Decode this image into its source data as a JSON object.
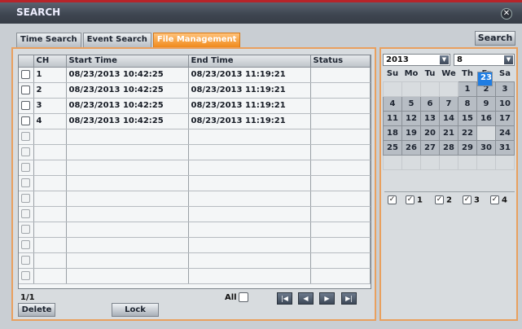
{
  "window": {
    "title": "SEARCH",
    "close_symbol": "✕"
  },
  "tabs": [
    {
      "label": "Time Search",
      "active": false
    },
    {
      "label": "Event Search",
      "active": false
    },
    {
      "label": "File Management",
      "active": true
    }
  ],
  "search_button": "Search",
  "table": {
    "columns": [
      "",
      "CH",
      "Start Time",
      "End Time",
      "Status"
    ],
    "rows": [
      {
        "ch": "1",
        "start": "08/23/2013 10:42:25",
        "end": "08/23/2013 11:19:21",
        "status": ""
      },
      {
        "ch": "2",
        "start": "08/23/2013 10:42:25",
        "end": "08/23/2013 11:19:21",
        "status": ""
      },
      {
        "ch": "3",
        "start": "08/23/2013 10:42:25",
        "end": "08/23/2013 11:19:21",
        "status": ""
      },
      {
        "ch": "4",
        "start": "08/23/2013 10:42:25",
        "end": "08/23/2013 11:19:21",
        "status": ""
      }
    ],
    "empty_rows": 10
  },
  "pager": {
    "page": "1/1",
    "all_label": "All",
    "nav": [
      "|◀",
      "◀",
      "▶",
      "▶|"
    ]
  },
  "buttons": {
    "delete": "Delete",
    "lock": "Lock"
  },
  "calendar": {
    "year": "2013",
    "month": "8",
    "weekdays": [
      "Su",
      "Mo",
      "Tu",
      "We",
      "Th",
      "Fr",
      "Sa"
    ],
    "weeks": [
      [
        "",
        "",
        "",
        "",
        "1",
        "2",
        "3"
      ],
      [
        "4",
        "5",
        "6",
        "7",
        "8",
        "9",
        "10"
      ],
      [
        "11",
        "12",
        "13",
        "14",
        "15",
        "16",
        "17"
      ],
      [
        "18",
        "19",
        "20",
        "21",
        "22",
        "23",
        "24"
      ],
      [
        "25",
        "26",
        "27",
        "28",
        "29",
        "30",
        "31"
      ],
      [
        "",
        "",
        "",
        "",
        "",
        "",
        ""
      ]
    ],
    "selected_day": "23"
  },
  "channels": [
    {
      "label": "",
      "checked": true
    },
    {
      "label": "1",
      "checked": true
    },
    {
      "label": "2",
      "checked": true
    },
    {
      "label": "3",
      "checked": true
    },
    {
      "label": "4",
      "checked": true
    }
  ],
  "colors": {
    "accent": "#f08a1c",
    "selected_day": "#1f7de3",
    "title_stripe": "#b7242a"
  }
}
